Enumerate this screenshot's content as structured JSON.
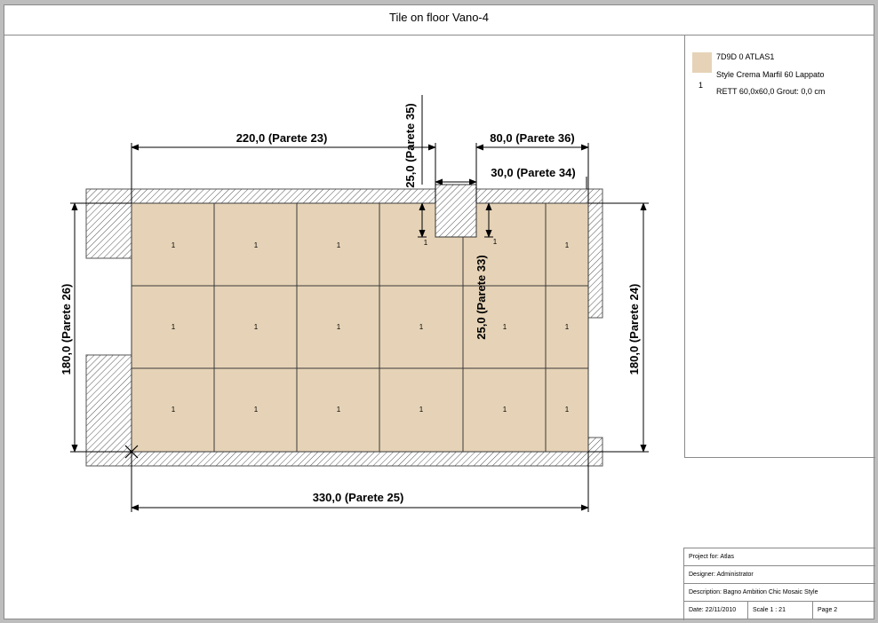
{
  "title": "Tile on floor Vano-4",
  "legend": {
    "swatch_color": "#e6d3b7",
    "number": "1",
    "code": "7D9D 0 ATLAS1",
    "name": "Style Crema Marfil 60 Lappato",
    "spec": "RETT 60,0x60,0 Grout: 0,0 cm"
  },
  "titleblock": {
    "project": "Project for: Atlas",
    "designer": "Designer: Administrator",
    "description": "Description: Bagno Ambition Chic Mosaic Style",
    "date": "Date: 22/11/2010",
    "scale": "Scale 1 : 21",
    "page": "Page 2"
  },
  "dimensions": {
    "top_left": "220,0 (Parete 23)",
    "top_right": "80,0 (Parete 36)",
    "notch_width": "30,0 (Parete 34)",
    "notch_depth_left": "25,0 (Parete 35)",
    "notch_depth_right": "25,0 (Parete 33)",
    "left": "180,0 (Parete 26)",
    "right": "180,0 (Parete 24)",
    "bottom": "330,0 (Parete 25)"
  },
  "tile_label": "1",
  "colors": {
    "tile": "#e6d3b7",
    "grout_line": "#3a3a3a",
    "wall_hatch": "#555555"
  }
}
